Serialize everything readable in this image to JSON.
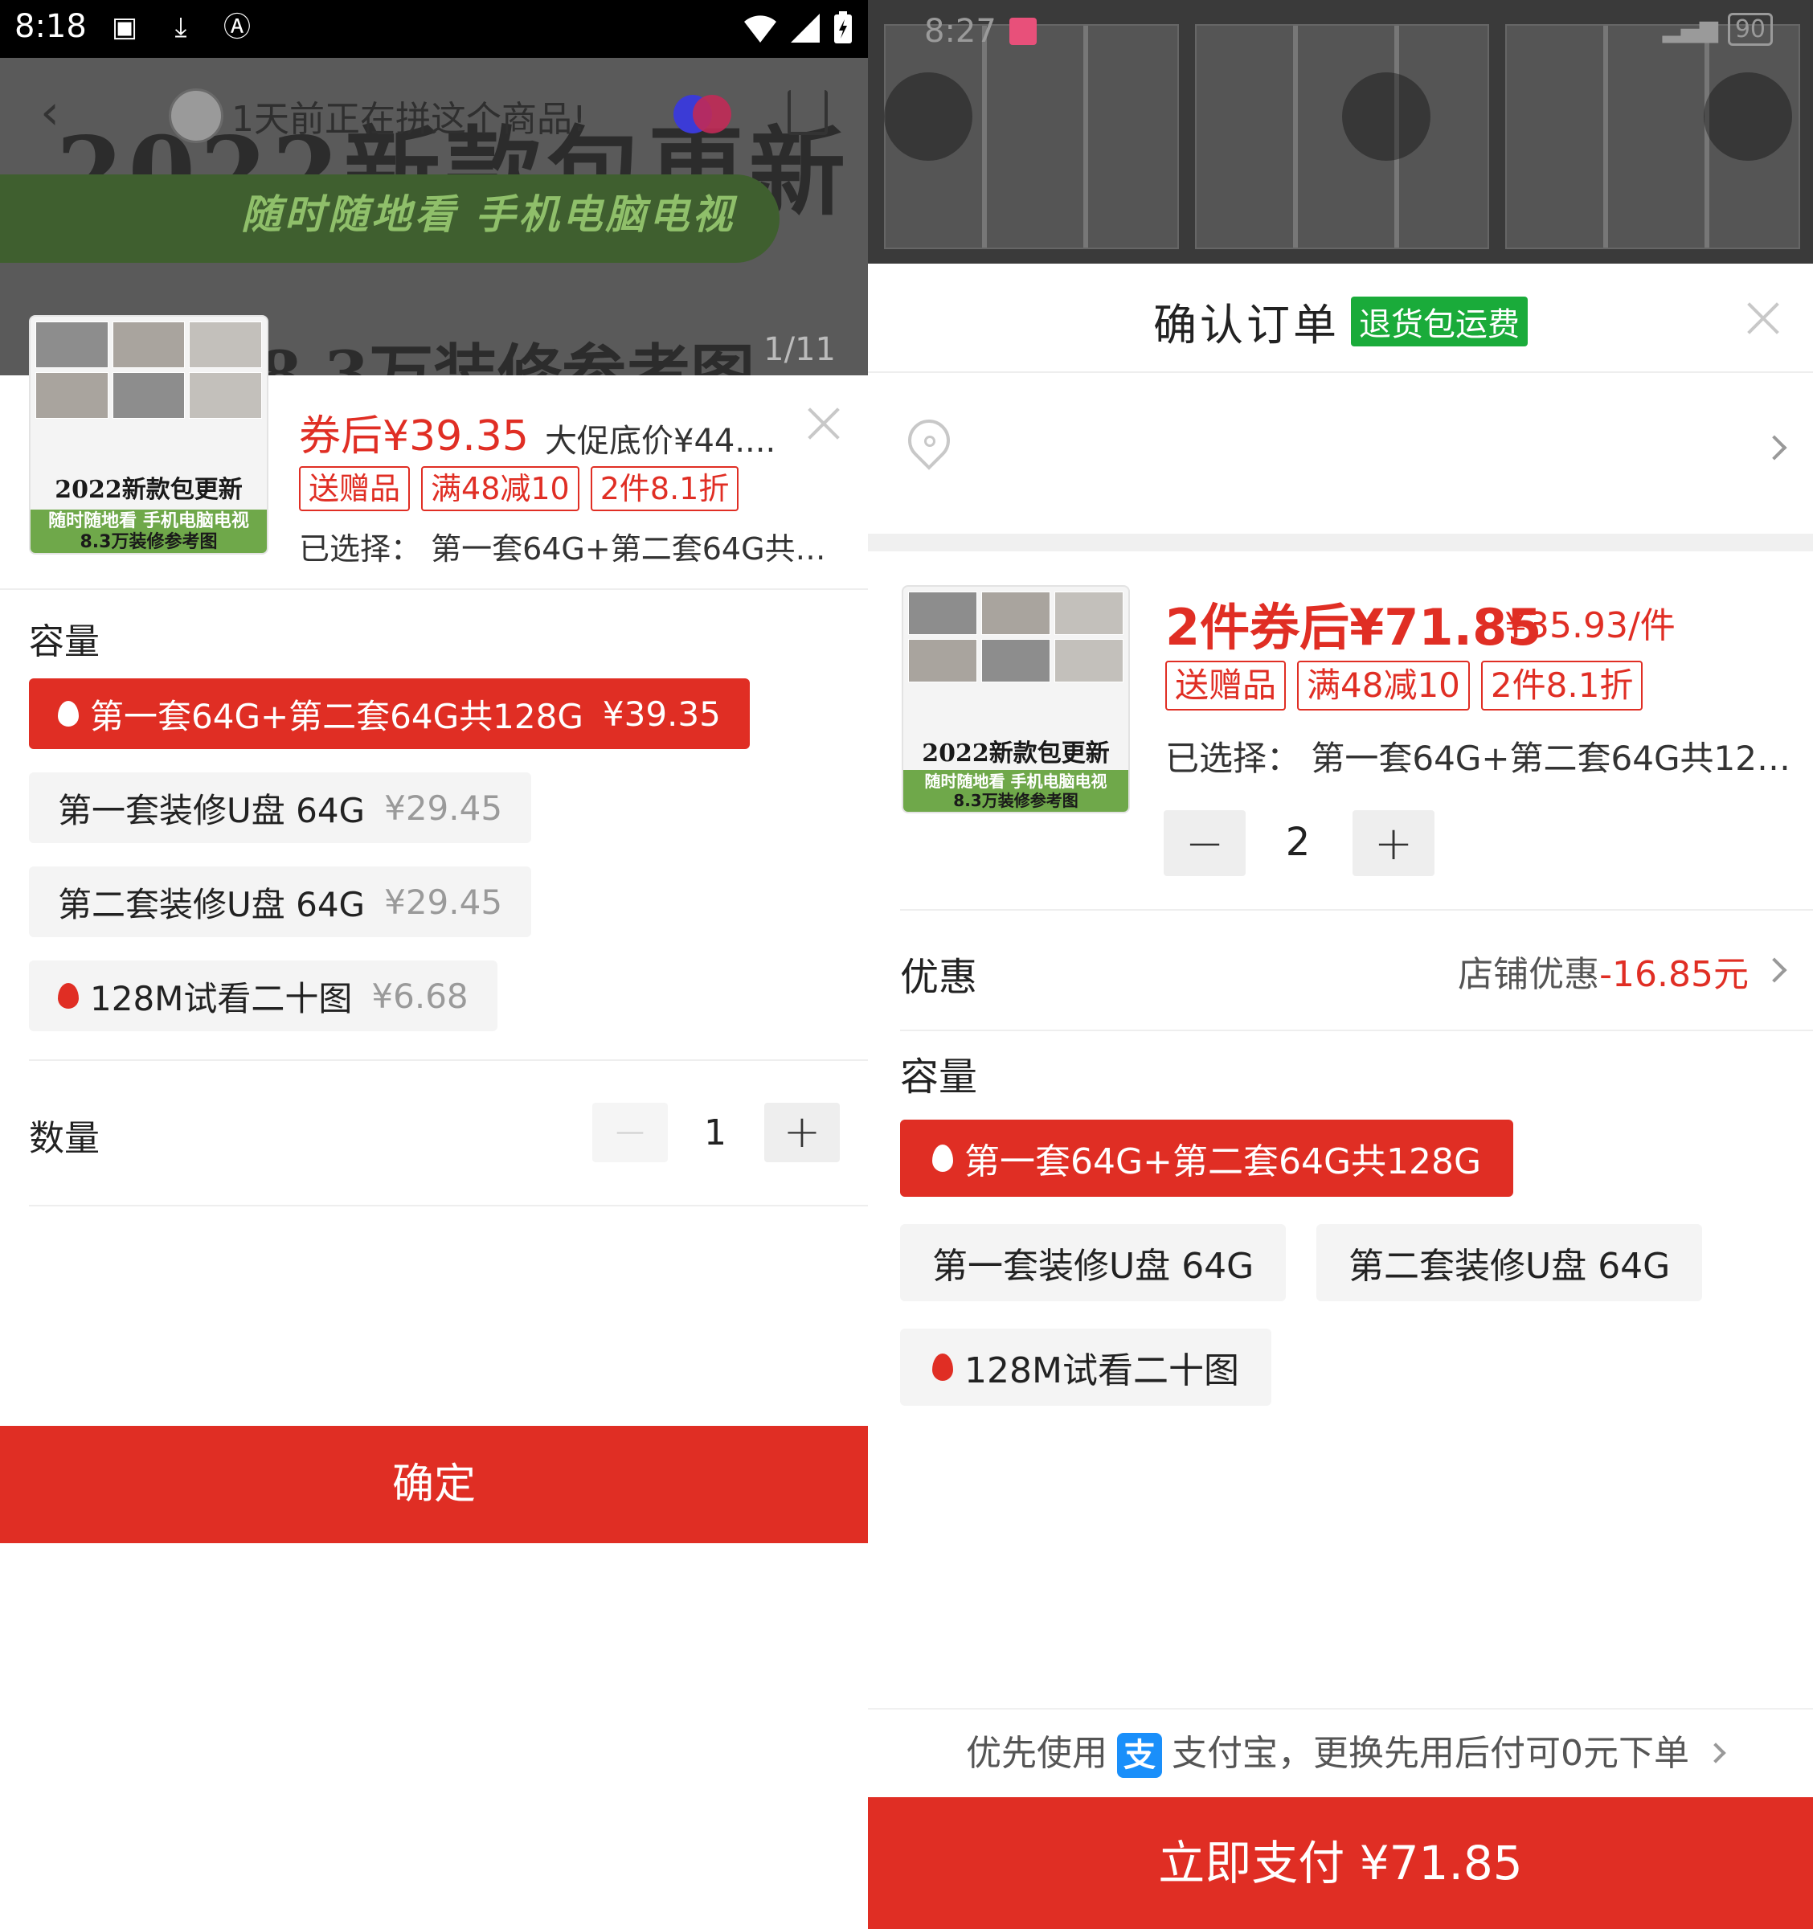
{
  "colors": {
    "accent": "#e02e24",
    "green_badge": "#1aab3a",
    "alipay": "#1a8ffa"
  },
  "left": {
    "status_bar": {
      "time": "8:18"
    },
    "header": {
      "group_hint": "1天前正在拼这个商品!",
      "image_counter": "1/11"
    },
    "product_image": {
      "big_text": "2022新款包更新",
      "pill_text": "随时随地看   手机电脑电视",
      "sub_text": "8.3万装修参考图"
    },
    "thumb": {
      "title": "2022新款包更新",
      "band_top": "随时随地看   手机电脑电视",
      "band_bottom": "8.3万装修参考图"
    },
    "price": {
      "label": "券后",
      "value": "¥39.35",
      "promo": "大促底价¥44...."
    },
    "tags": [
      "送赠品",
      "满48减10",
      "2件8.1折"
    ],
    "selected": "已选择：  第一套64G+第二套64G共1...",
    "capacity_label": "容量",
    "options": [
      {
        "name": "第一套64G+第二套64G共128G",
        "price": "¥39.35"
      },
      {
        "name": "第一套装修U盘 64G",
        "price": "¥29.45"
      },
      {
        "name": "第二套装修U盘 64G",
        "price": "¥29.45"
      },
      {
        "name": "128M试看二十图",
        "price": "¥6.68"
      }
    ],
    "quantity": {
      "label": "数量",
      "minus": "−",
      "value": "1",
      "plus": "+"
    },
    "confirm_label": "确定"
  },
  "right": {
    "status_bar": {
      "time": "8:27",
      "battery": "90"
    },
    "title": "确认订单",
    "title_badge": "退货包运费",
    "thumb": {
      "title": "2022新款包更新",
      "band_top": "随时随地看   手机电脑电视",
      "band_bottom": "8.3万装修参考图"
    },
    "price": {
      "main": "2件券后¥71.85",
      "unit": "¥35.93/件"
    },
    "tags": [
      "送赠品",
      "满48减10",
      "2件8.1折"
    ],
    "selected": "已选择：  第一套64G+第二套64G共128G",
    "quantity": {
      "minus": "−",
      "value": "2",
      "plus": "+"
    },
    "discount": {
      "label": "优惠",
      "store": "店铺优惠",
      "amount": "-16.85元"
    },
    "capacity_label": "容量",
    "options": [
      {
        "name": "第一套64G+第二套64G共128G"
      },
      {
        "name": "第一套装修U盘 64G"
      },
      {
        "name": "第二套装修U盘 64G"
      },
      {
        "name": "128M试看二十图"
      }
    ],
    "pay_hint": {
      "prefix": "优先使用",
      "alipay_icon": "支",
      "suffix": "支付宝，更换先用后付可0元下单"
    },
    "pay_button": "立即支付 ¥71.85"
  }
}
